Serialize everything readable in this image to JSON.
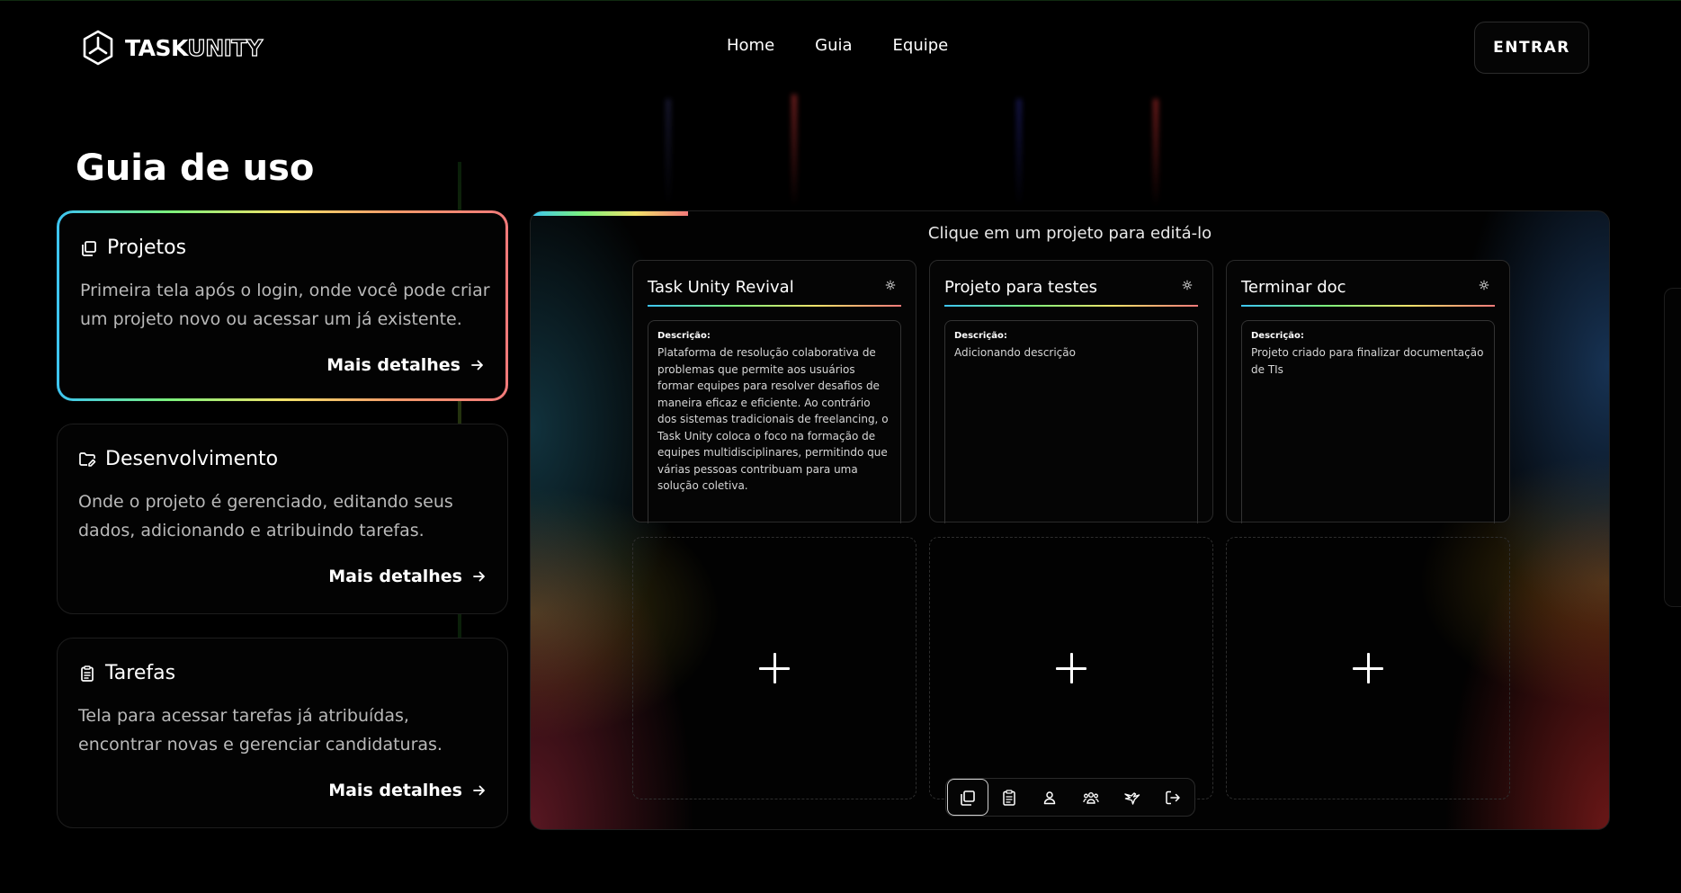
{
  "brand": {
    "name_bold": "TASK",
    "name_outline": "UNITY"
  },
  "nav": {
    "home": "Home",
    "guide": "Guia",
    "team": "Equipe"
  },
  "header": {
    "login_label": "ENTRAR"
  },
  "page": {
    "title": "Guia de uso"
  },
  "sections": [
    {
      "title": "Projetos",
      "description": "Primeira tela após o login, onde você pode criar um projeto novo ou acessar um já existente.",
      "link": "Mais detalhes",
      "icon": "copy-icon",
      "active": true
    },
    {
      "title": "Desenvolvimento",
      "description": "Onde o projeto é gerenciado, editando seus dados, adicionando e atribuindo tarefas.",
      "link": "Mais detalhes",
      "icon": "folder-edit-icon",
      "active": false
    },
    {
      "title": "Tarefas",
      "description": "Tela para acessar tarefas já atribuídas, encontrar novas e gerenciar candidaturas.",
      "link": "Mais detalhes",
      "icon": "clipboard-icon",
      "active": false
    }
  ],
  "preview": {
    "hint": "Clique em um projeto para editá-lo",
    "description_label": "Descrição:",
    "projects": [
      {
        "title": "Task Unity Revival",
        "description": "Plataforma de resolução colaborativa de problemas que permite aos usuários formar equipes para resolver desafios de maneira eficaz e eficiente. Ao contrário dos sistemas tradicionais de freelancing, o Task Unity coloca o foco na formação de equipes multidisciplinares, permitindo que várias pessoas contribuam para uma solução coletiva."
      },
      {
        "title": "Projeto para testes",
        "description": "Adicionando descrição"
      },
      {
        "title": "Terminar doc",
        "description": "Projeto criado para finalizar documentação de TIs"
      }
    ],
    "dock": [
      "projects-icon",
      "tasks-icon",
      "profile-icon",
      "team-icon",
      "bird-icon",
      "logout-icon"
    ]
  },
  "colors": {
    "gradient": [
      "#3dc5f2",
      "#7cf27c",
      "#f2e26a",
      "#f27a7a"
    ],
    "background": "#000000"
  }
}
